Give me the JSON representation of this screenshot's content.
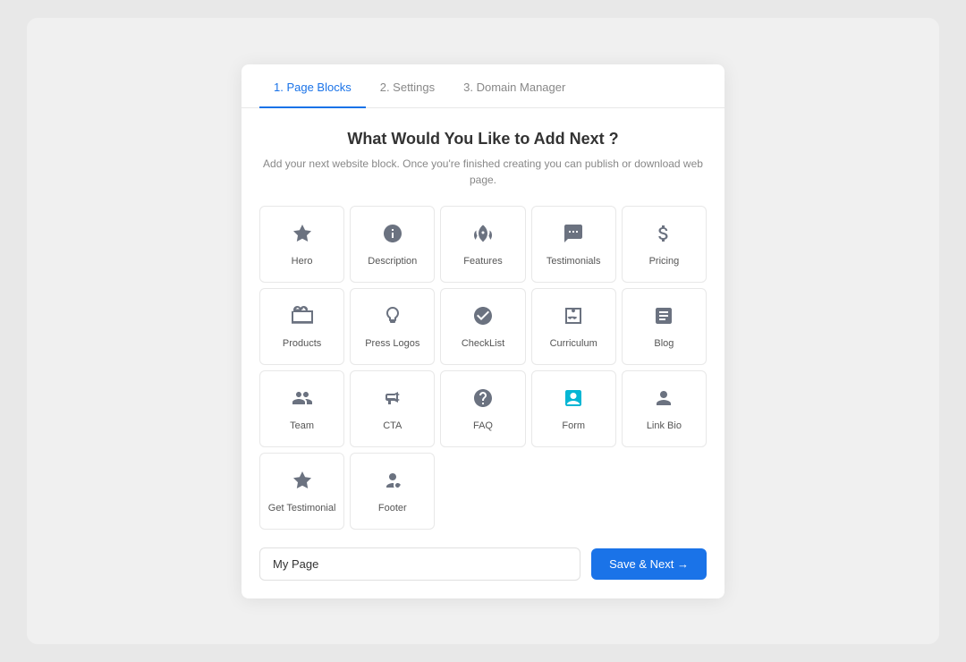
{
  "tabs": [
    {
      "id": "page-blocks",
      "label": "1. Page Blocks",
      "active": true
    },
    {
      "id": "settings",
      "label": "2. Settings",
      "active": false
    },
    {
      "id": "domain-manager",
      "label": "3. Domain Manager",
      "active": false
    }
  ],
  "modal": {
    "title": "What Would You Like to Add Next ?",
    "subtitle": "Add your next website block. Once you're finished creating you can publish or download web page."
  },
  "blocks": [
    {
      "id": "hero",
      "label": "Hero"
    },
    {
      "id": "description",
      "label": "Description"
    },
    {
      "id": "features",
      "label": "Features"
    },
    {
      "id": "testimonials",
      "label": "Testimonials"
    },
    {
      "id": "pricing",
      "label": "Pricing"
    },
    {
      "id": "products",
      "label": "Products"
    },
    {
      "id": "press-logos",
      "label": "Press Logos"
    },
    {
      "id": "checklist",
      "label": "CheckList"
    },
    {
      "id": "curriculum",
      "label": "Curriculum"
    },
    {
      "id": "blog",
      "label": "Blog"
    },
    {
      "id": "team",
      "label": "Team"
    },
    {
      "id": "cta",
      "label": "CTA"
    },
    {
      "id": "faq",
      "label": "FAQ"
    },
    {
      "id": "form",
      "label": "Form"
    },
    {
      "id": "link-bio",
      "label": "Link Bio"
    },
    {
      "id": "get-testimonial",
      "label": "Get Testimonial"
    },
    {
      "id": "footer",
      "label": "Footer"
    }
  ],
  "footer": {
    "page_name_placeholder": "My Page",
    "page_name_value": "My Page",
    "save_button_label": "Save & Next →"
  }
}
